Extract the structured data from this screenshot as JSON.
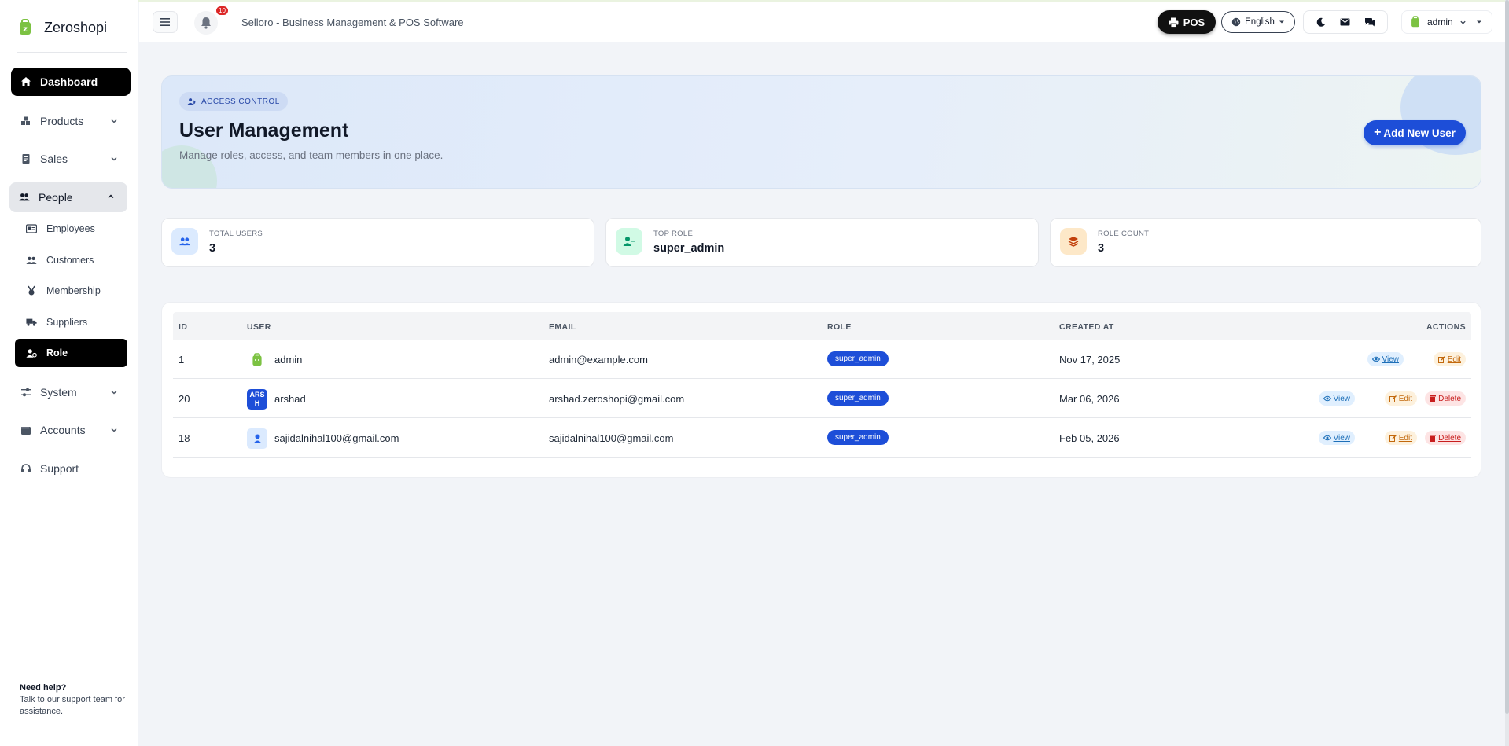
{
  "brand": {
    "name": "Zeroshopi"
  },
  "sidebar": {
    "items": [
      {
        "label": "Dashboard",
        "icon": "home-icon"
      },
      {
        "label": "Products",
        "icon": "boxes-icon"
      },
      {
        "label": "Sales",
        "icon": "receipt-icon"
      },
      {
        "label": "People",
        "icon": "users-icon"
      },
      {
        "label": "System",
        "icon": "sliders-icon"
      },
      {
        "label": "Accounts",
        "icon": "wallet-icon"
      },
      {
        "label": "Support",
        "icon": "headset-icon"
      }
    ],
    "people_sub": [
      {
        "label": "Employees",
        "icon": "id-card-icon"
      },
      {
        "label": "Customers",
        "icon": "users-icon"
      },
      {
        "label": "Membership",
        "icon": "medal-icon"
      },
      {
        "label": "Suppliers",
        "icon": "truck-icon"
      },
      {
        "label": "Role",
        "icon": "user-gear-icon"
      }
    ],
    "help": {
      "title": "Need help?",
      "text": "Talk to our support team for assistance."
    }
  },
  "topbar": {
    "notification_count": "10",
    "app_title": "Selloro - Business Management & POS Software",
    "pos_label": "POS",
    "language": "English",
    "user_name": "admin"
  },
  "hero": {
    "chip": "ACCESS CONTROL",
    "title": "User Management",
    "subtitle": "Manage roles, access, and team members in one place.",
    "add_button": "Add New User"
  },
  "stats": [
    {
      "label": "TOTAL USERS",
      "value": "3",
      "color": "#dbeafe"
    },
    {
      "label": "TOP ROLE",
      "value": "super_admin",
      "color": "#d1fae5"
    },
    {
      "label": "ROLE COUNT",
      "value": "3",
      "color": "#fde8c8"
    }
  ],
  "table": {
    "headers": {
      "id": "ID",
      "user": "USER",
      "email": "EMAIL",
      "role": "ROLE",
      "created": "CREATED AT",
      "actions": "ACTIONS"
    },
    "rows": [
      {
        "id": "1",
        "user": "admin",
        "email": "admin@example.com",
        "role": "super_admin",
        "created": "Nov 17, 2025"
      },
      {
        "id": "20",
        "user": "arshad",
        "avatar_alt": "ARSH",
        "email": "arshad.zeroshopi@gmail.com",
        "role": "super_admin",
        "created": "Mar 06, 2026"
      },
      {
        "id": "18",
        "user": "sajidalnihal100@gmail.com",
        "email": "sajidalnihal100@gmail.com",
        "role": "super_admin",
        "created": "Feb 05, 2026"
      }
    ],
    "actions": {
      "view": "View",
      "edit": "Edit",
      "delete": "Delete"
    }
  },
  "colors": {
    "accent": "#1d4ed8",
    "brand_green": "#7cc242",
    "danger": "#dc2626"
  }
}
